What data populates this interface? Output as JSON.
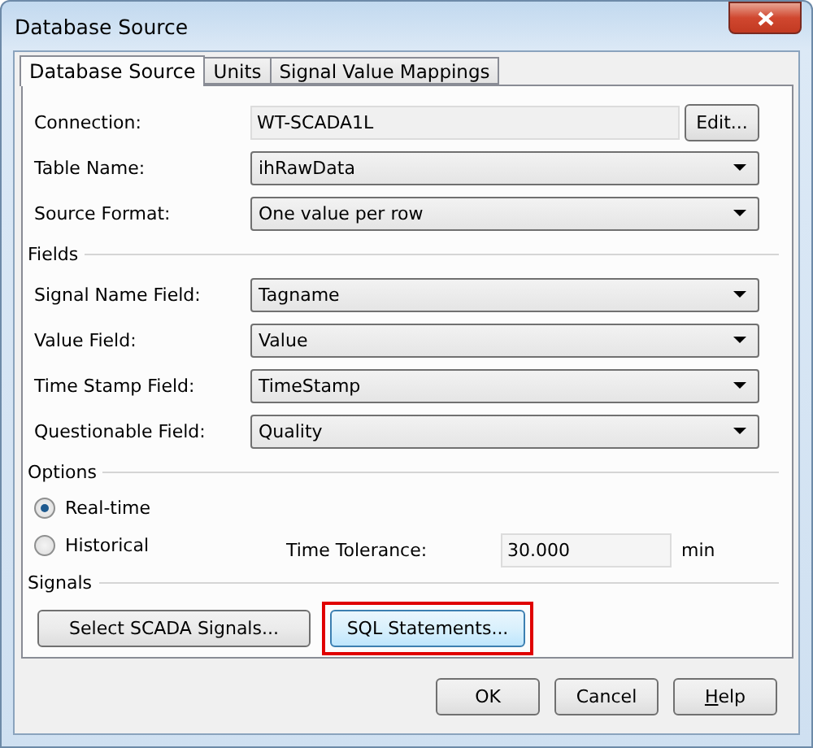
{
  "window": {
    "title": "Database Source"
  },
  "tabs": [
    {
      "label": "Database Source",
      "selected": true
    },
    {
      "label": "Units",
      "selected": false
    },
    {
      "label": "Signal Value Mappings",
      "selected": false
    }
  ],
  "connection": {
    "label": "Connection:",
    "value": "WT-SCADA1L",
    "button": "Edit..."
  },
  "source": [
    {
      "label": "Table Name:",
      "value": "ihRawData"
    },
    {
      "label": "Source Format:",
      "value": "One value per row"
    }
  ],
  "fields": {
    "title": "Fields",
    "items": [
      {
        "label": "Signal Name Field:",
        "value": "Tagname"
      },
      {
        "label": "Value Field:",
        "value": "Value"
      },
      {
        "label": "Time Stamp Field:",
        "value": "TimeStamp"
      },
      {
        "label": "Questionable Field:",
        "value": "Quality"
      }
    ]
  },
  "options": {
    "title": "Options",
    "modes": [
      {
        "label": "Real-time",
        "selected": true
      },
      {
        "label": "Historical",
        "selected": false
      }
    ],
    "tolerance": {
      "label": "Time Tolerance:",
      "value": "30.000",
      "unit": "min"
    }
  },
  "signals": {
    "title": "Signals",
    "buttons": [
      {
        "label": "Select SCADA Signals...",
        "highlighted": false
      },
      {
        "label": "SQL Statements...",
        "highlighted": true
      }
    ]
  },
  "buttons": [
    {
      "label": "OK"
    },
    {
      "label": "Cancel"
    },
    {
      "label": "Help",
      "mnemonic_first": true
    }
  ]
}
